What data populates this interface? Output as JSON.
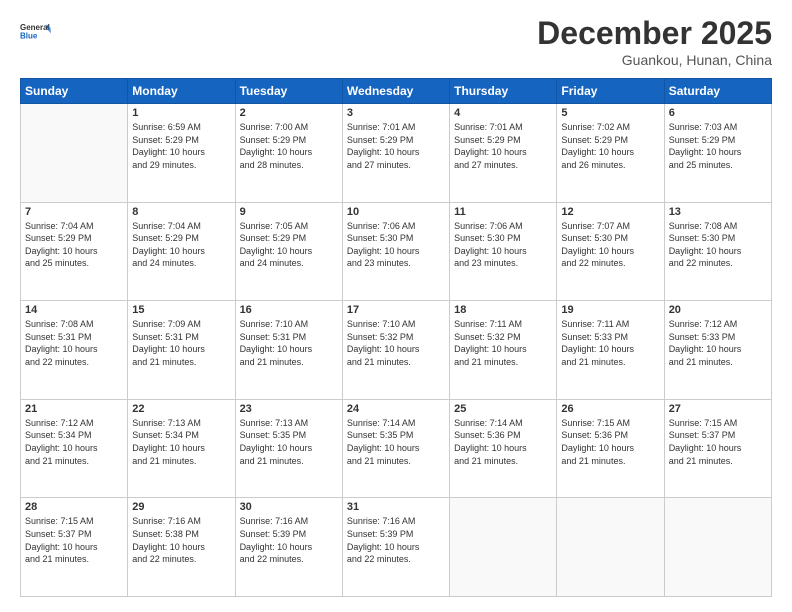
{
  "logo": {
    "line1": "General",
    "line2": "Blue"
  },
  "title": "December 2025",
  "subtitle": "Guankou, Hunan, China",
  "days_header": [
    "Sunday",
    "Monday",
    "Tuesday",
    "Wednesday",
    "Thursday",
    "Friday",
    "Saturday"
  ],
  "weeks": [
    [
      {
        "day": "",
        "empty": true
      },
      {
        "day": "1",
        "sunrise": "6:59 AM",
        "sunset": "5:29 PM",
        "daylight": "10 hours and 29 minutes."
      },
      {
        "day": "2",
        "sunrise": "7:00 AM",
        "sunset": "5:29 PM",
        "daylight": "10 hours and 28 minutes."
      },
      {
        "day": "3",
        "sunrise": "7:01 AM",
        "sunset": "5:29 PM",
        "daylight": "10 hours and 27 minutes."
      },
      {
        "day": "4",
        "sunrise": "7:01 AM",
        "sunset": "5:29 PM",
        "daylight": "10 hours and 27 minutes."
      },
      {
        "day": "5",
        "sunrise": "7:02 AM",
        "sunset": "5:29 PM",
        "daylight": "10 hours and 26 minutes."
      },
      {
        "day": "6",
        "sunrise": "7:03 AM",
        "sunset": "5:29 PM",
        "daylight": "10 hours and 25 minutes."
      }
    ],
    [
      {
        "day": "7",
        "sunrise": "7:04 AM",
        "sunset": "5:29 PM",
        "daylight": "10 hours and 25 minutes."
      },
      {
        "day": "8",
        "sunrise": "7:04 AM",
        "sunset": "5:29 PM",
        "daylight": "10 hours and 24 minutes."
      },
      {
        "day": "9",
        "sunrise": "7:05 AM",
        "sunset": "5:29 PM",
        "daylight": "10 hours and 24 minutes."
      },
      {
        "day": "10",
        "sunrise": "7:06 AM",
        "sunset": "5:30 PM",
        "daylight": "10 hours and 23 minutes."
      },
      {
        "day": "11",
        "sunrise": "7:06 AM",
        "sunset": "5:30 PM",
        "daylight": "10 hours and 23 minutes."
      },
      {
        "day": "12",
        "sunrise": "7:07 AM",
        "sunset": "5:30 PM",
        "daylight": "10 hours and 22 minutes."
      },
      {
        "day": "13",
        "sunrise": "7:08 AM",
        "sunset": "5:30 PM",
        "daylight": "10 hours and 22 minutes."
      }
    ],
    [
      {
        "day": "14",
        "sunrise": "7:08 AM",
        "sunset": "5:31 PM",
        "daylight": "10 hours and 22 minutes."
      },
      {
        "day": "15",
        "sunrise": "7:09 AM",
        "sunset": "5:31 PM",
        "daylight": "10 hours and 21 minutes."
      },
      {
        "day": "16",
        "sunrise": "7:10 AM",
        "sunset": "5:31 PM",
        "daylight": "10 hours and 21 minutes."
      },
      {
        "day": "17",
        "sunrise": "7:10 AM",
        "sunset": "5:32 PM",
        "daylight": "10 hours and 21 minutes."
      },
      {
        "day": "18",
        "sunrise": "7:11 AM",
        "sunset": "5:32 PM",
        "daylight": "10 hours and 21 minutes."
      },
      {
        "day": "19",
        "sunrise": "7:11 AM",
        "sunset": "5:33 PM",
        "daylight": "10 hours and 21 minutes."
      },
      {
        "day": "20",
        "sunrise": "7:12 AM",
        "sunset": "5:33 PM",
        "daylight": "10 hours and 21 minutes."
      }
    ],
    [
      {
        "day": "21",
        "sunrise": "7:12 AM",
        "sunset": "5:34 PM",
        "daylight": "10 hours and 21 minutes."
      },
      {
        "day": "22",
        "sunrise": "7:13 AM",
        "sunset": "5:34 PM",
        "daylight": "10 hours and 21 minutes."
      },
      {
        "day": "23",
        "sunrise": "7:13 AM",
        "sunset": "5:35 PM",
        "daylight": "10 hours and 21 minutes."
      },
      {
        "day": "24",
        "sunrise": "7:14 AM",
        "sunset": "5:35 PM",
        "daylight": "10 hours and 21 minutes."
      },
      {
        "day": "25",
        "sunrise": "7:14 AM",
        "sunset": "5:36 PM",
        "daylight": "10 hours and 21 minutes."
      },
      {
        "day": "26",
        "sunrise": "7:15 AM",
        "sunset": "5:36 PM",
        "daylight": "10 hours and 21 minutes."
      },
      {
        "day": "27",
        "sunrise": "7:15 AM",
        "sunset": "5:37 PM",
        "daylight": "10 hours and 21 minutes."
      }
    ],
    [
      {
        "day": "28",
        "sunrise": "7:15 AM",
        "sunset": "5:37 PM",
        "daylight": "10 hours and 21 minutes."
      },
      {
        "day": "29",
        "sunrise": "7:16 AM",
        "sunset": "5:38 PM",
        "daylight": "10 hours and 22 minutes."
      },
      {
        "day": "30",
        "sunrise": "7:16 AM",
        "sunset": "5:39 PM",
        "daylight": "10 hours and 22 minutes."
      },
      {
        "day": "31",
        "sunrise": "7:16 AM",
        "sunset": "5:39 PM",
        "daylight": "10 hours and 22 minutes."
      },
      {
        "day": "",
        "empty": true
      },
      {
        "day": "",
        "empty": true
      },
      {
        "day": "",
        "empty": true
      }
    ]
  ]
}
